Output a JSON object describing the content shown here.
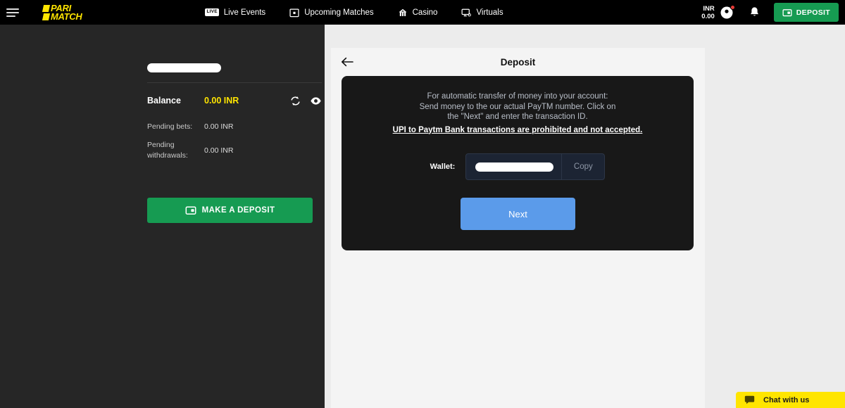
{
  "header": {
    "menu_icon": "hamburger-menu-icon",
    "logo": {
      "line1": "PARI",
      "line2": "MATCH"
    },
    "nav": [
      {
        "label": "Live Events",
        "icon": "live-badge-icon",
        "badge": "LIVE"
      },
      {
        "label": "Upcoming Matches",
        "icon": "calendar-icon"
      },
      {
        "label": "Casino",
        "icon": "casino-icon"
      },
      {
        "label": "Virtuals",
        "icon": "monitor-icon"
      }
    ],
    "currency_code": "INR",
    "currency_amount": "0.00",
    "account_icon": "user-account-icon",
    "notifications_icon": "bell-icon",
    "deposit_label": "DEPOSIT",
    "deposit_icon": "wallet-icon"
  },
  "sidebar": {
    "username_redacted": "",
    "balance_label": "Balance",
    "balance_value": "0.00 INR",
    "refresh_icon": "refresh-icon",
    "visibility_icon": "eye-icon",
    "pending_bets_label": "Pending bets:",
    "pending_bets_value": "0.00 INR",
    "pending_withdrawals_label": "Pending withdrawals:",
    "pending_withdrawals_value": "0.00 INR",
    "make_deposit_label": "MAKE A DEPOSIT",
    "make_deposit_icon": "wallet-icon"
  },
  "deposit": {
    "back_icon": "back-arrow-icon",
    "title": "Deposit",
    "info_line1": "For automatic transfer of money into your account:",
    "info_line2": "Send money to the our actual PayTM number. Click on",
    "info_line3": "the \"Next\" and enter the transaction ID.",
    "warning": "UPI to Paytm Bank transactions are prohibited and not accepted.",
    "wallet_label": "Wallet:",
    "wallet_value_redacted": "",
    "copy_label": "Copy",
    "next_label": "Next"
  },
  "chat": {
    "icon": "chat-bubble-icon",
    "label": "Chat with us"
  },
  "colors": {
    "header_bg": "#000000",
    "sidebar_bg": "#262626",
    "page_bg": "#ececec",
    "card_bg": "#f4f4f4",
    "panel_bg": "#181818",
    "brand_yellow": "#ffe500",
    "green": "#169b52",
    "blue": "#5b9bea",
    "badge_red": "#e53935"
  }
}
